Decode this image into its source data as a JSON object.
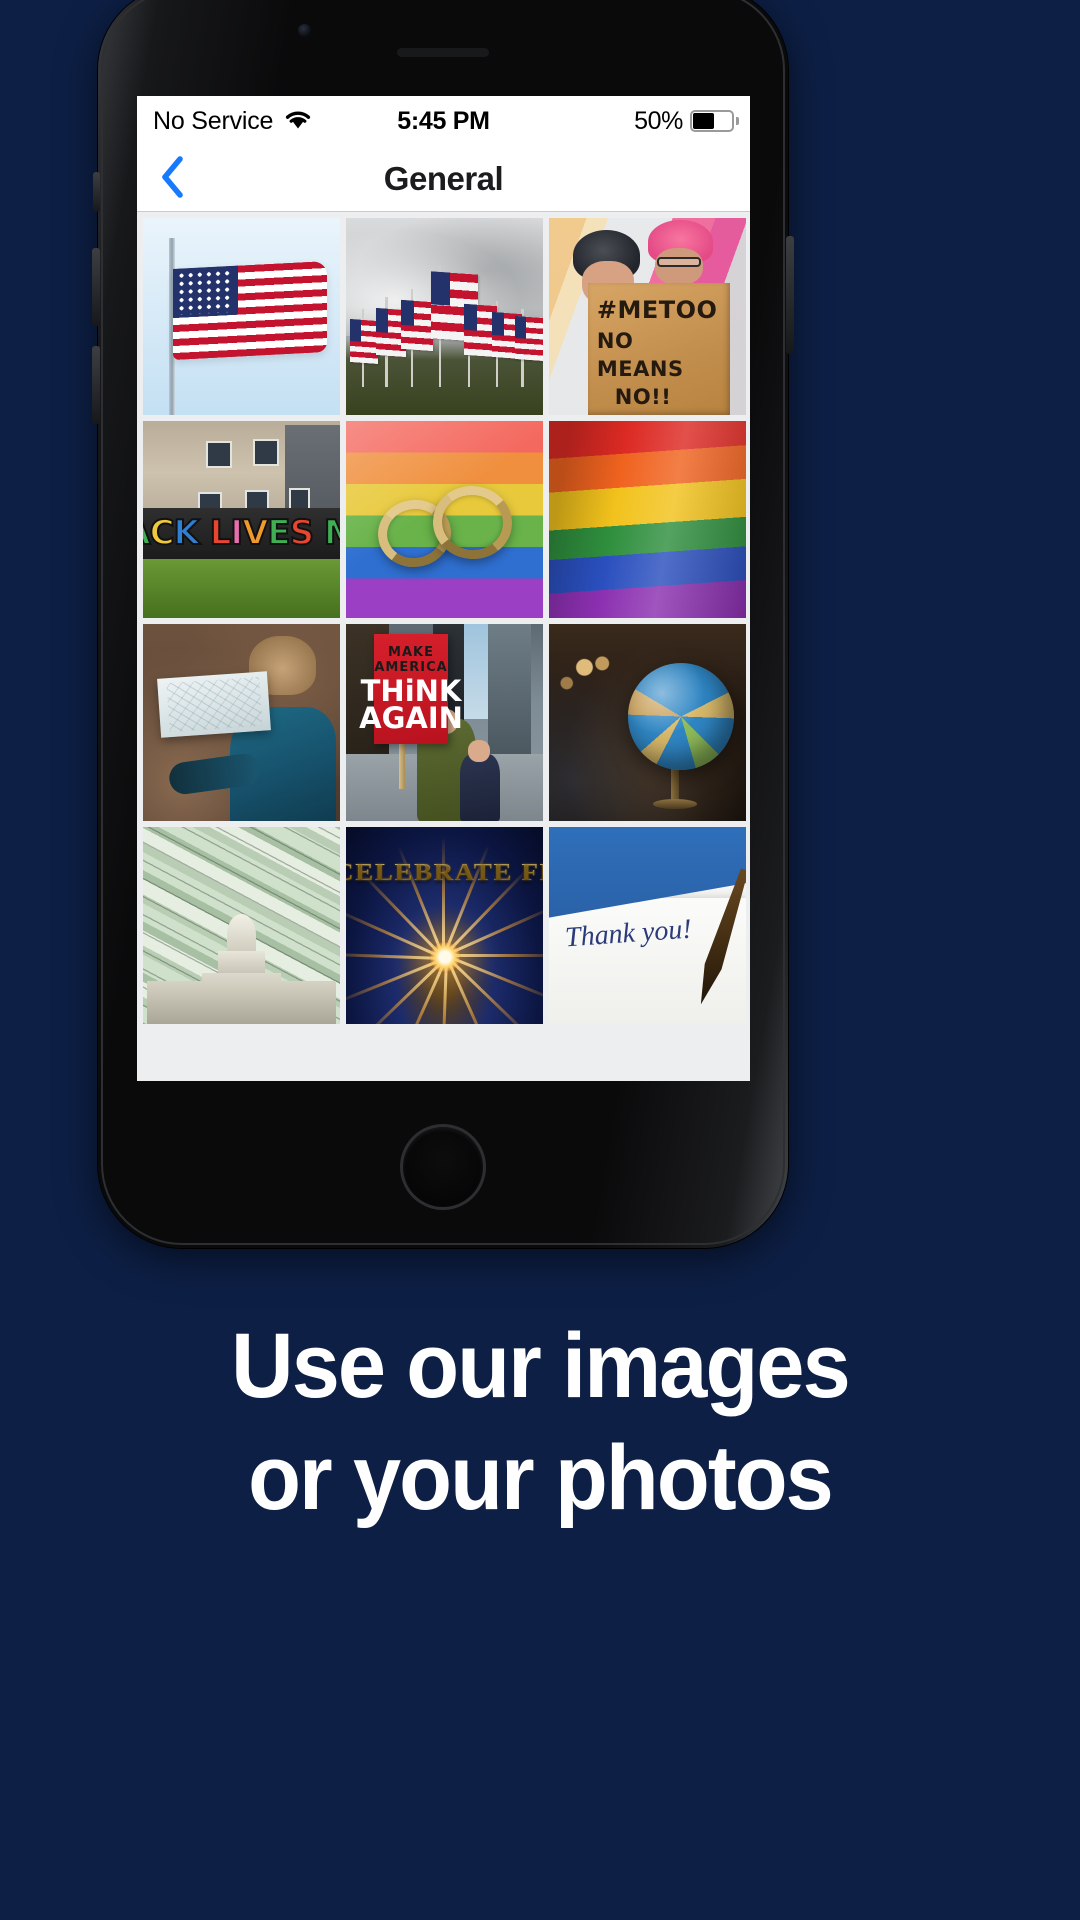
{
  "background_color": "#0d1f45",
  "device": {
    "frame_color": "#0a0a0b",
    "home_button": "home-button",
    "earpiece": "earpiece-speaker"
  },
  "status_bar": {
    "carrier": "No Service",
    "wifi_icon": "wifi-icon",
    "time": "5:45 PM",
    "battery_percent": "50%",
    "battery_level": 50,
    "battery_icon": "battery-icon"
  },
  "nav_bar": {
    "back_icon": "chevron-left-icon",
    "back_label": "",
    "title": "General"
  },
  "gallery": {
    "columns": 3,
    "photos": [
      {
        "id": "us-flag-sky",
        "alt": "American flag waving against a blue sky",
        "style": "flag1"
      },
      {
        "id": "field-of-flags",
        "alt": "Field of American flags under overcast sky",
        "style": "flagfield"
      },
      {
        "id": "metoo-protest",
        "alt": "Protester holding cardboard sign",
        "style": "metoo",
        "sign_lines": [
          "#METOO",
          "NO MEANS",
          "NO!!"
        ]
      },
      {
        "id": "black-lives-matter-mural",
        "alt": "Black Lives Matter graffiti mural on wall",
        "style": "blm",
        "mural_text": "BLACK LIVES MATTER"
      },
      {
        "id": "wedding-rings-rainbow",
        "alt": "Two wedding rings on a rainbow pride flag",
        "style": "rings"
      },
      {
        "id": "rainbow-pride-flag",
        "alt": "Close-up of rainbow pride flag fabric",
        "style": "pride"
      },
      {
        "id": "child-with-map",
        "alt": "Child in blue jacket reading a paper map",
        "style": "map"
      },
      {
        "id": "make-america-think-again",
        "alt": "Man and boy at a march holding a red protest sign",
        "style": "think",
        "sign_lines": [
          "MAKE",
          "AMERICA",
          "THiNK",
          "AGAIN"
        ]
      },
      {
        "id": "world-globe",
        "alt": "World globe on a stand with warm bokeh lights",
        "style": "globe"
      },
      {
        "id": "capitol-money",
        "alt": "US Capitol dome over a pile of hundred dollar bills",
        "style": "capitol"
      },
      {
        "id": "celebrate-freedom",
        "alt": "Fireworks sparkler with gold title text",
        "style": "freedom",
        "title": "CELEBRATE FREEDOM"
      },
      {
        "id": "thank-you-card",
        "alt": "Handwritten thank you note with a fountain pen",
        "style": "thanks",
        "note": "Thank you!"
      }
    ]
  },
  "promo": {
    "line1": "Use our images",
    "line2": "or your photos",
    "text_color": "#ffffff"
  }
}
